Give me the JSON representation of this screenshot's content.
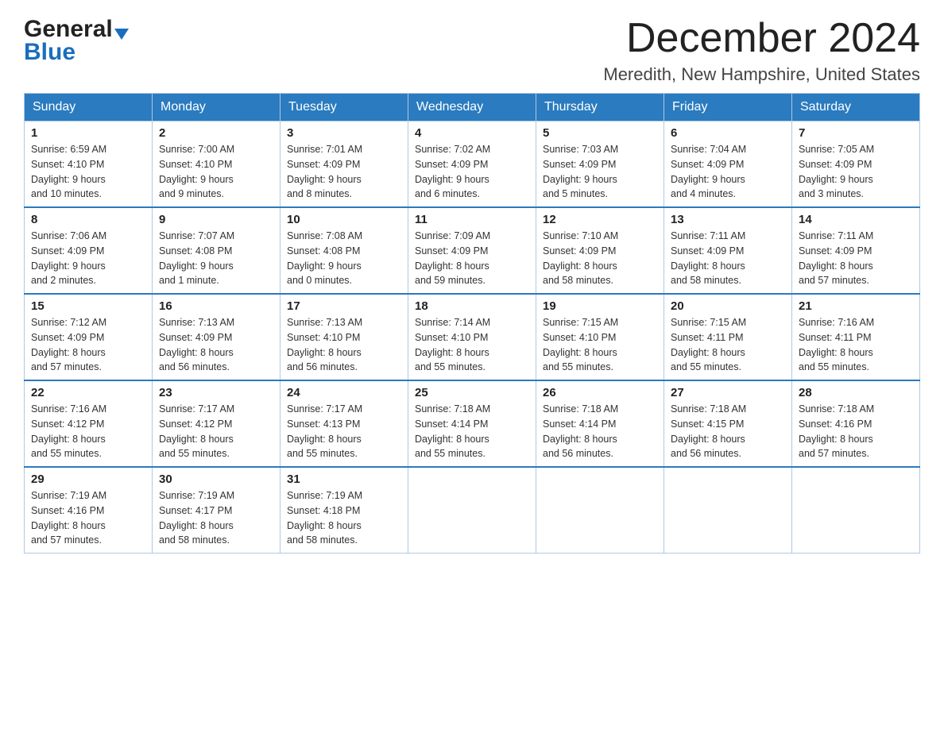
{
  "header": {
    "logo_general": "General",
    "logo_blue": "Blue",
    "month": "December 2024",
    "location": "Meredith, New Hampshire, United States"
  },
  "days_of_week": [
    "Sunday",
    "Monday",
    "Tuesday",
    "Wednesday",
    "Thursday",
    "Friday",
    "Saturday"
  ],
  "weeks": [
    [
      {
        "day": "1",
        "sunrise": "6:59 AM",
        "sunset": "4:10 PM",
        "daylight": "9 hours and 10 minutes."
      },
      {
        "day": "2",
        "sunrise": "7:00 AM",
        "sunset": "4:10 PM",
        "daylight": "9 hours and 9 minutes."
      },
      {
        "day": "3",
        "sunrise": "7:01 AM",
        "sunset": "4:09 PM",
        "daylight": "9 hours and 8 minutes."
      },
      {
        "day": "4",
        "sunrise": "7:02 AM",
        "sunset": "4:09 PM",
        "daylight": "9 hours and 6 minutes."
      },
      {
        "day": "5",
        "sunrise": "7:03 AM",
        "sunset": "4:09 PM",
        "daylight": "9 hours and 5 minutes."
      },
      {
        "day": "6",
        "sunrise": "7:04 AM",
        "sunset": "4:09 PM",
        "daylight": "9 hours and 4 minutes."
      },
      {
        "day": "7",
        "sunrise": "7:05 AM",
        "sunset": "4:09 PM",
        "daylight": "9 hours and 3 minutes."
      }
    ],
    [
      {
        "day": "8",
        "sunrise": "7:06 AM",
        "sunset": "4:09 PM",
        "daylight": "9 hours and 2 minutes."
      },
      {
        "day": "9",
        "sunrise": "7:07 AM",
        "sunset": "4:08 PM",
        "daylight": "9 hours and 1 minute."
      },
      {
        "day": "10",
        "sunrise": "7:08 AM",
        "sunset": "4:08 PM",
        "daylight": "9 hours and 0 minutes."
      },
      {
        "day": "11",
        "sunrise": "7:09 AM",
        "sunset": "4:09 PM",
        "daylight": "8 hours and 59 minutes."
      },
      {
        "day": "12",
        "sunrise": "7:10 AM",
        "sunset": "4:09 PM",
        "daylight": "8 hours and 58 minutes."
      },
      {
        "day": "13",
        "sunrise": "7:11 AM",
        "sunset": "4:09 PM",
        "daylight": "8 hours and 58 minutes."
      },
      {
        "day": "14",
        "sunrise": "7:11 AM",
        "sunset": "4:09 PM",
        "daylight": "8 hours and 57 minutes."
      }
    ],
    [
      {
        "day": "15",
        "sunrise": "7:12 AM",
        "sunset": "4:09 PM",
        "daylight": "8 hours and 57 minutes."
      },
      {
        "day": "16",
        "sunrise": "7:13 AM",
        "sunset": "4:09 PM",
        "daylight": "8 hours and 56 minutes."
      },
      {
        "day": "17",
        "sunrise": "7:13 AM",
        "sunset": "4:10 PM",
        "daylight": "8 hours and 56 minutes."
      },
      {
        "day": "18",
        "sunrise": "7:14 AM",
        "sunset": "4:10 PM",
        "daylight": "8 hours and 55 minutes."
      },
      {
        "day": "19",
        "sunrise": "7:15 AM",
        "sunset": "4:10 PM",
        "daylight": "8 hours and 55 minutes."
      },
      {
        "day": "20",
        "sunrise": "7:15 AM",
        "sunset": "4:11 PM",
        "daylight": "8 hours and 55 minutes."
      },
      {
        "day": "21",
        "sunrise": "7:16 AM",
        "sunset": "4:11 PM",
        "daylight": "8 hours and 55 minutes."
      }
    ],
    [
      {
        "day": "22",
        "sunrise": "7:16 AM",
        "sunset": "4:12 PM",
        "daylight": "8 hours and 55 minutes."
      },
      {
        "day": "23",
        "sunrise": "7:17 AM",
        "sunset": "4:12 PM",
        "daylight": "8 hours and 55 minutes."
      },
      {
        "day": "24",
        "sunrise": "7:17 AM",
        "sunset": "4:13 PM",
        "daylight": "8 hours and 55 minutes."
      },
      {
        "day": "25",
        "sunrise": "7:18 AM",
        "sunset": "4:14 PM",
        "daylight": "8 hours and 55 minutes."
      },
      {
        "day": "26",
        "sunrise": "7:18 AM",
        "sunset": "4:14 PM",
        "daylight": "8 hours and 56 minutes."
      },
      {
        "day": "27",
        "sunrise": "7:18 AM",
        "sunset": "4:15 PM",
        "daylight": "8 hours and 56 minutes."
      },
      {
        "day": "28",
        "sunrise": "7:18 AM",
        "sunset": "4:16 PM",
        "daylight": "8 hours and 57 minutes."
      }
    ],
    [
      {
        "day": "29",
        "sunrise": "7:19 AM",
        "sunset": "4:16 PM",
        "daylight": "8 hours and 57 minutes."
      },
      {
        "day": "30",
        "sunrise": "7:19 AM",
        "sunset": "4:17 PM",
        "daylight": "8 hours and 58 minutes."
      },
      {
        "day": "31",
        "sunrise": "7:19 AM",
        "sunset": "4:18 PM",
        "daylight": "8 hours and 58 minutes."
      },
      null,
      null,
      null,
      null
    ]
  ],
  "labels": {
    "sunrise": "Sunrise:",
    "sunset": "Sunset:",
    "daylight": "Daylight:"
  }
}
